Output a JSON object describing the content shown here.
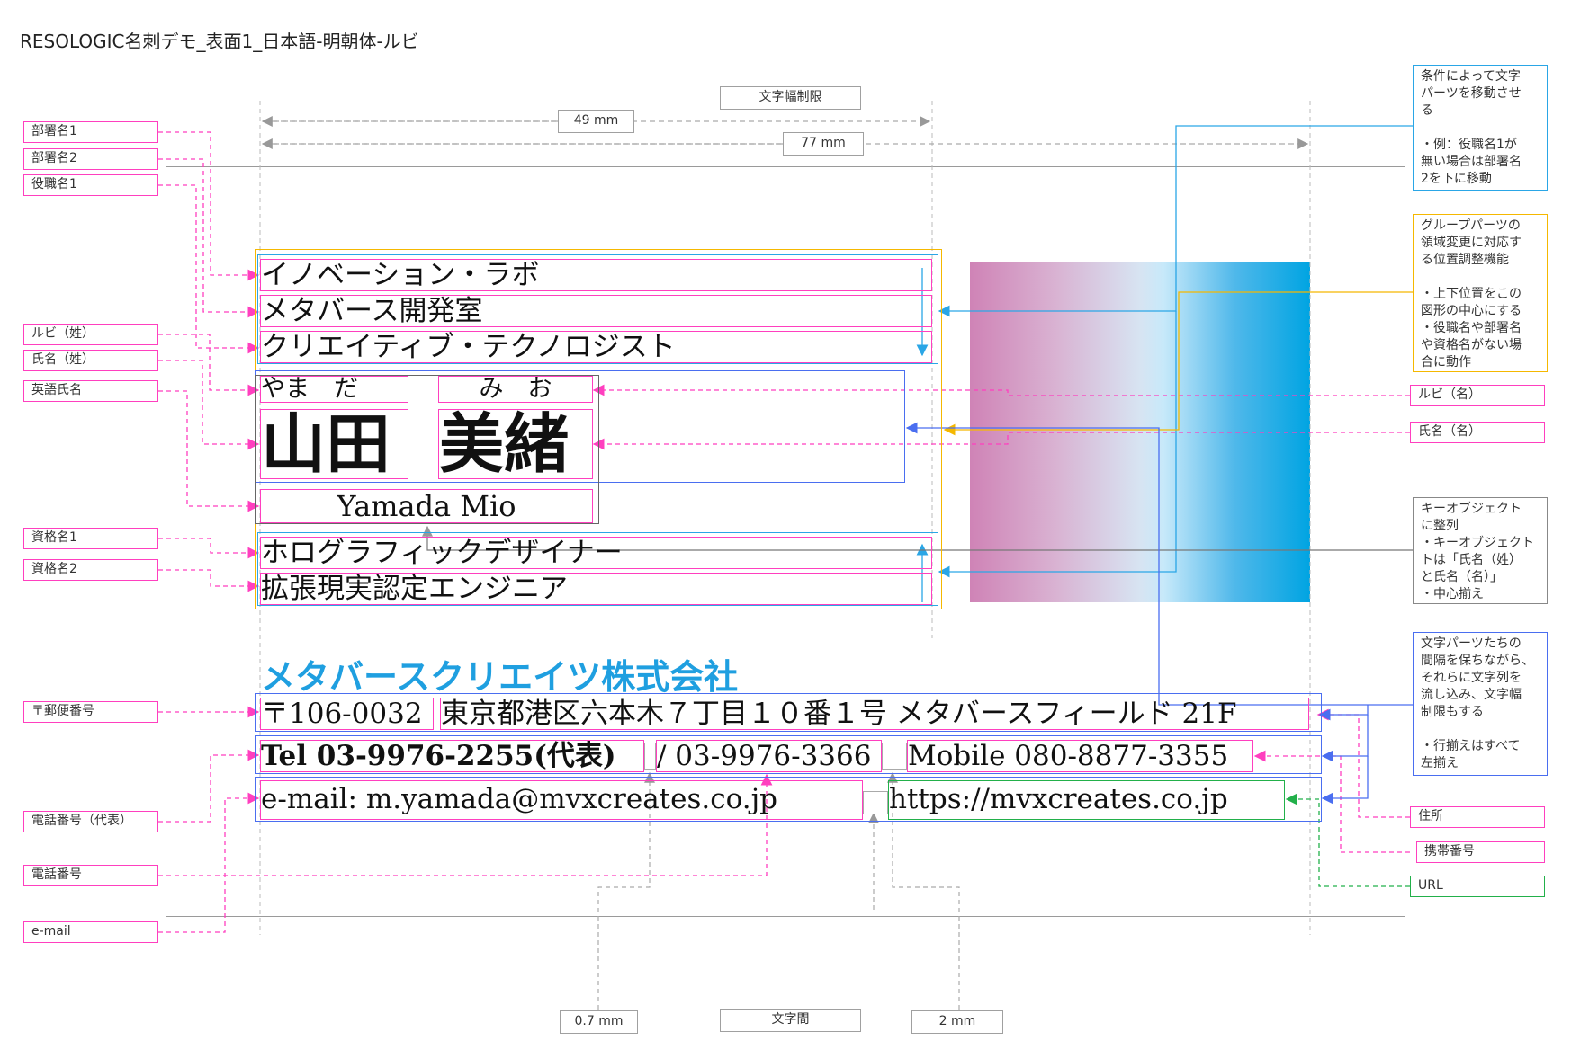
{
  "title": "RESOLOGIC名刺デモ_表面1_日本語-明朝体-ルビ",
  "left_labels": {
    "dept1": "部署名1",
    "dept2": "部署名2",
    "position1": "役職名1",
    "ruby_last": "ルビ（姓）",
    "name_last": "氏名（姓）",
    "english_name": "英語氏名",
    "qual1": "資格名1",
    "qual2": "資格名2",
    "postal": "〒郵便番号",
    "tel_main": "電話番号（代表）",
    "tel": "電話番号",
    "email": "e-mail"
  },
  "right_labels": {
    "ruby_first": "ルビ（名）",
    "name_first": "氏名（名）",
    "address": "住所",
    "mobile": "携帯番号",
    "url": "URL"
  },
  "dimensions": {
    "width_limit": "文字幅制限",
    "d49": "49 mm",
    "d77": "77 mm",
    "char_spacing": "文字間",
    "d07": "0.7 mm",
    "d2": "2 mm"
  },
  "notes": {
    "move": "条件によって文字\nパーツを移動させ\nる\n\n・例：役職名1が\n無い場合は部署名\n2を下に移動",
    "group": "グループパーツの\n領域変更に対応す\nる位置調整機能\n\n・上下位置をこの\n図形の中心にする\n・役職名や部署名\nや資格名がない場\n合に動作",
    "key": "キーオブジェクト\nに整列\n・キーオブジェクト\nトは「氏名（姓）\nと氏名（名）」\n・中心揃え",
    "flow": "文字パーツたちの\n間隔を保ちながら、\nそれらに文字列を\n流し込み、文字幅\n制限もする\n\n・行揃えはすべて\n左揃え"
  },
  "card": {
    "dept1": "イノベーション・ラボ",
    "dept2": "メタバース開発室",
    "position1": "クリエイティブ・テクノロジスト",
    "ruby_last": "やま　だ",
    "ruby_first": "み　お",
    "name_last": "山田",
    "name_first": "美緒",
    "english_name": "Yamada Mio",
    "qual1": "ホログラフィックデザイナー",
    "qual2": "拡張現実認定エンジニア",
    "company": "メタバースクリエイツ株式会社",
    "postal": "〒106-0032",
    "address": "東京都港区六本木７丁目１０番１号 メタバースフィールド 21F",
    "tel_main": "Tel 03-9976-2255(代表)",
    "tel": "/ 03-9976-3366",
    "mobile": "Mobile 080-8877-3355",
    "email": "e-mail: m.yamada@mvxcreates.co.jp",
    "url": "https://mvxcreates.co.jp"
  },
  "colors": {
    "field_border": "#ff3fbf",
    "group_border": "#f5b800",
    "align_border": "#2aa6e6",
    "flow_border": "#4a6ef0",
    "url_border": "#22b04a",
    "company_text": "#1f9fe0"
  }
}
